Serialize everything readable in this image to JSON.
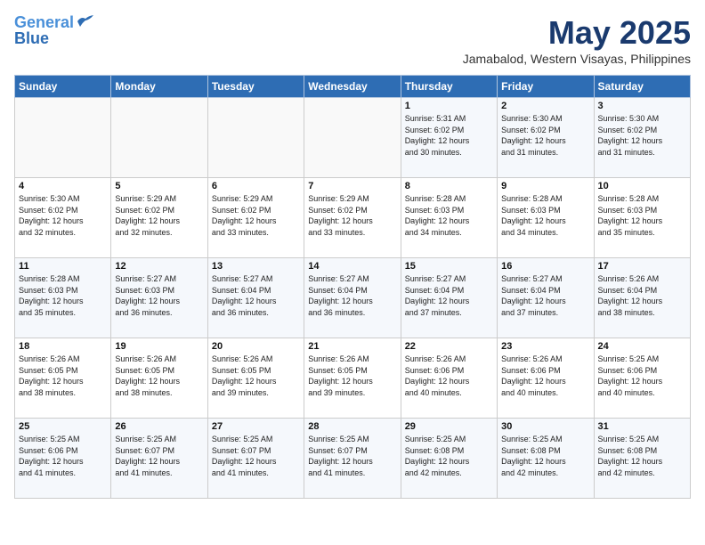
{
  "logo": {
    "line1": "General",
    "line2": "Blue"
  },
  "title": {
    "month_year": "May 2025",
    "location": "Jamabalod, Western Visayas, Philippines"
  },
  "days_of_week": [
    "Sunday",
    "Monday",
    "Tuesday",
    "Wednesday",
    "Thursday",
    "Friday",
    "Saturday"
  ],
  "weeks": [
    [
      {
        "day": "",
        "info": ""
      },
      {
        "day": "",
        "info": ""
      },
      {
        "day": "",
        "info": ""
      },
      {
        "day": "",
        "info": ""
      },
      {
        "day": "1",
        "info": "Sunrise: 5:31 AM\nSunset: 6:02 PM\nDaylight: 12 hours\nand 30 minutes."
      },
      {
        "day": "2",
        "info": "Sunrise: 5:30 AM\nSunset: 6:02 PM\nDaylight: 12 hours\nand 31 minutes."
      },
      {
        "day": "3",
        "info": "Sunrise: 5:30 AM\nSunset: 6:02 PM\nDaylight: 12 hours\nand 31 minutes."
      }
    ],
    [
      {
        "day": "4",
        "info": "Sunrise: 5:30 AM\nSunset: 6:02 PM\nDaylight: 12 hours\nand 32 minutes."
      },
      {
        "day": "5",
        "info": "Sunrise: 5:29 AM\nSunset: 6:02 PM\nDaylight: 12 hours\nand 32 minutes."
      },
      {
        "day": "6",
        "info": "Sunrise: 5:29 AM\nSunset: 6:02 PM\nDaylight: 12 hours\nand 33 minutes."
      },
      {
        "day": "7",
        "info": "Sunrise: 5:29 AM\nSunset: 6:02 PM\nDaylight: 12 hours\nand 33 minutes."
      },
      {
        "day": "8",
        "info": "Sunrise: 5:28 AM\nSunset: 6:03 PM\nDaylight: 12 hours\nand 34 minutes."
      },
      {
        "day": "9",
        "info": "Sunrise: 5:28 AM\nSunset: 6:03 PM\nDaylight: 12 hours\nand 34 minutes."
      },
      {
        "day": "10",
        "info": "Sunrise: 5:28 AM\nSunset: 6:03 PM\nDaylight: 12 hours\nand 35 minutes."
      }
    ],
    [
      {
        "day": "11",
        "info": "Sunrise: 5:28 AM\nSunset: 6:03 PM\nDaylight: 12 hours\nand 35 minutes."
      },
      {
        "day": "12",
        "info": "Sunrise: 5:27 AM\nSunset: 6:03 PM\nDaylight: 12 hours\nand 36 minutes."
      },
      {
        "day": "13",
        "info": "Sunrise: 5:27 AM\nSunset: 6:04 PM\nDaylight: 12 hours\nand 36 minutes."
      },
      {
        "day": "14",
        "info": "Sunrise: 5:27 AM\nSunset: 6:04 PM\nDaylight: 12 hours\nand 36 minutes."
      },
      {
        "day": "15",
        "info": "Sunrise: 5:27 AM\nSunset: 6:04 PM\nDaylight: 12 hours\nand 37 minutes."
      },
      {
        "day": "16",
        "info": "Sunrise: 5:27 AM\nSunset: 6:04 PM\nDaylight: 12 hours\nand 37 minutes."
      },
      {
        "day": "17",
        "info": "Sunrise: 5:26 AM\nSunset: 6:04 PM\nDaylight: 12 hours\nand 38 minutes."
      }
    ],
    [
      {
        "day": "18",
        "info": "Sunrise: 5:26 AM\nSunset: 6:05 PM\nDaylight: 12 hours\nand 38 minutes."
      },
      {
        "day": "19",
        "info": "Sunrise: 5:26 AM\nSunset: 6:05 PM\nDaylight: 12 hours\nand 38 minutes."
      },
      {
        "day": "20",
        "info": "Sunrise: 5:26 AM\nSunset: 6:05 PM\nDaylight: 12 hours\nand 39 minutes."
      },
      {
        "day": "21",
        "info": "Sunrise: 5:26 AM\nSunset: 6:05 PM\nDaylight: 12 hours\nand 39 minutes."
      },
      {
        "day": "22",
        "info": "Sunrise: 5:26 AM\nSunset: 6:06 PM\nDaylight: 12 hours\nand 40 minutes."
      },
      {
        "day": "23",
        "info": "Sunrise: 5:26 AM\nSunset: 6:06 PM\nDaylight: 12 hours\nand 40 minutes."
      },
      {
        "day": "24",
        "info": "Sunrise: 5:25 AM\nSunset: 6:06 PM\nDaylight: 12 hours\nand 40 minutes."
      }
    ],
    [
      {
        "day": "25",
        "info": "Sunrise: 5:25 AM\nSunset: 6:06 PM\nDaylight: 12 hours\nand 41 minutes."
      },
      {
        "day": "26",
        "info": "Sunrise: 5:25 AM\nSunset: 6:07 PM\nDaylight: 12 hours\nand 41 minutes."
      },
      {
        "day": "27",
        "info": "Sunrise: 5:25 AM\nSunset: 6:07 PM\nDaylight: 12 hours\nand 41 minutes."
      },
      {
        "day": "28",
        "info": "Sunrise: 5:25 AM\nSunset: 6:07 PM\nDaylight: 12 hours\nand 41 minutes."
      },
      {
        "day": "29",
        "info": "Sunrise: 5:25 AM\nSunset: 6:08 PM\nDaylight: 12 hours\nand 42 minutes."
      },
      {
        "day": "30",
        "info": "Sunrise: 5:25 AM\nSunset: 6:08 PM\nDaylight: 12 hours\nand 42 minutes."
      },
      {
        "day": "31",
        "info": "Sunrise: 5:25 AM\nSunset: 6:08 PM\nDaylight: 12 hours\nand 42 minutes."
      }
    ]
  ]
}
